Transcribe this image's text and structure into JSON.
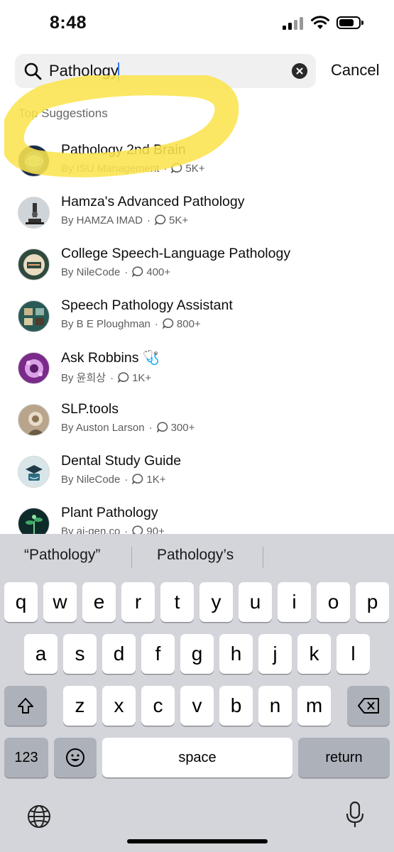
{
  "status_bar": {
    "time": "8:48"
  },
  "search": {
    "value": "Pathology",
    "cancel_label": "Cancel"
  },
  "section_label": "Top Suggestions",
  "results": [
    {
      "title": "Pathology 2nd Brain",
      "author": "By ISU Management",
      "count": "5K+",
      "avatar_color": "#1b2a4a"
    },
    {
      "title": "Hamza's Advanced Pathology",
      "author": "By HAMZA IMAD",
      "count": "5K+",
      "avatar_color": "#cfd4d8"
    },
    {
      "title": "College Speech-Language Pathology",
      "author": "By NileCode",
      "count": "400+",
      "avatar_color": "#2f4a3e"
    },
    {
      "title": "Speech Pathology Assistant",
      "author": "By B E Ploughman",
      "count": "800+",
      "avatar_color": "#2a5a55"
    },
    {
      "title": "Ask Robbins 🩺",
      "author": "By 윤희상",
      "count": "1K+",
      "avatar_color": "#7a2a8a"
    },
    {
      "title": "SLP.tools",
      "author": "By Auston Larson",
      "count": "300+",
      "avatar_color": "#b9a58c"
    },
    {
      "title": "Dental Study Guide",
      "author": "By NileCode",
      "count": "1K+",
      "avatar_color": "#d8e6ea"
    },
    {
      "title": "Plant Pathology",
      "author": "By ai-gen.co",
      "count": "90+",
      "avatar_color": "#0e2b2a"
    }
  ],
  "keyboard": {
    "suggestions": [
      "“Pathology”",
      "Pathology’s"
    ],
    "row1": [
      "q",
      "w",
      "e",
      "r",
      "t",
      "y",
      "u",
      "i",
      "o",
      "p"
    ],
    "row2": [
      "a",
      "s",
      "d",
      "f",
      "g",
      "h",
      "j",
      "k",
      "l"
    ],
    "row3": [
      "z",
      "x",
      "c",
      "v",
      "b",
      "n",
      "m"
    ],
    "numbers_label": "123",
    "space_label": "space",
    "return_label": "return"
  },
  "colors": {
    "highlight": "#fbe44d",
    "caret": "#3478f6",
    "keyboard_bg": "#d3d5da"
  }
}
